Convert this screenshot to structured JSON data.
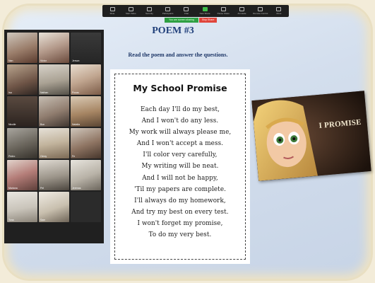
{
  "toolbar": {
    "items": [
      {
        "label": "Mute",
        "icon": "mic-icon"
      },
      {
        "label": "Start Video",
        "icon": "video-icon"
      },
      {
        "label": "Security",
        "icon": "shield-icon"
      },
      {
        "label": "Participants",
        "icon": "people-icon"
      },
      {
        "label": "Chat",
        "icon": "chat-icon"
      },
      {
        "label": "New Share",
        "icon": "share-icon"
      },
      {
        "label": "Pause Share",
        "icon": "pause-icon"
      },
      {
        "label": "Annotate",
        "icon": "pencil-icon"
      },
      {
        "label": "Remote Control",
        "icon": "remote-icon"
      },
      {
        "label": "More",
        "icon": "more-icon"
      }
    ],
    "sharing_status": "You are screen sharing",
    "stop_share_label": "Stop Share"
  },
  "gallery": {
    "participants": [
      {
        "name": "Nan"
      },
      {
        "name": "Victor"
      },
      {
        "name": "Jerson"
      },
      {
        "name": "Isa"
      },
      {
        "name": "Nathan"
      },
      {
        "name": "Pocas"
      },
      {
        "name": "Nicolle"
      },
      {
        "name": "Bon"
      },
      {
        "name": "Natalia"
      },
      {
        "name": "Pedro"
      },
      {
        "name": "Ginny"
      },
      {
        "name": "Fe"
      },
      {
        "name": "Mariana"
      },
      {
        "name": "Pel"
      },
      {
        "name": "Jerenas"
      },
      {
        "name": "Tona"
      },
      {
        "name": "Sam"
      },
      {
        "name": ""
      }
    ]
  },
  "slide": {
    "title": "POEM #3",
    "instruction": "Read the poem and answer the questions.",
    "poem_title": "My School Promise",
    "poem_lines": [
      "Each day I'll do my best,",
      "And I won't do any less.",
      "My work will always please me,",
      "And I won't accept a mess.",
      "I'll color very carefully,",
      "My writing will be neat.",
      "And I will not be happy,",
      "'Til my papers are complete.",
      "I'll always do my homework,",
      "And try my best on every test.",
      "I won't forget my promise,",
      "To do my very best."
    ],
    "image_caption": "I PROMISE"
  },
  "colors": {
    "title": "#203f7a",
    "frame": "#d3deed",
    "toolbar": "#1f1f1f",
    "share_green": "#2ea043",
    "stop_red": "#e0453b"
  }
}
